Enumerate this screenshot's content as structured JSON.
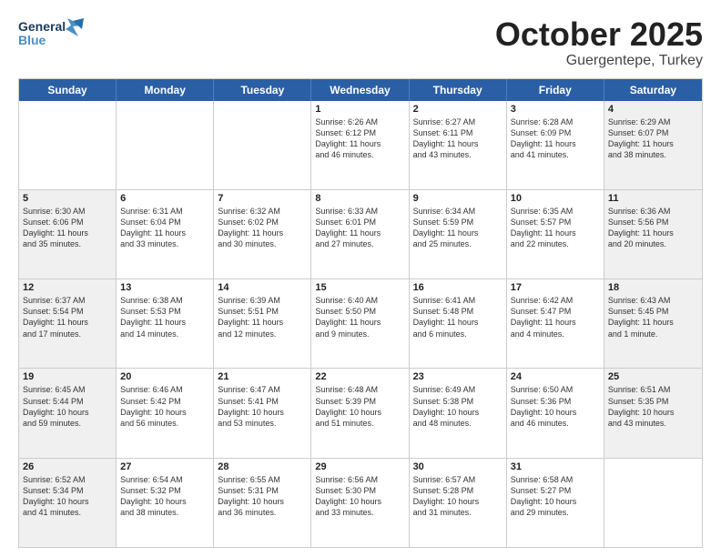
{
  "header": {
    "logo_line1": "General",
    "logo_line2": "Blue",
    "title": "October 2025",
    "subtitle": "Guergentepe, Turkey"
  },
  "calendar": {
    "weekdays": [
      "Sunday",
      "Monday",
      "Tuesday",
      "Wednesday",
      "Thursday",
      "Friday",
      "Saturday"
    ],
    "rows": [
      [
        {
          "day": "",
          "text": "",
          "empty": true
        },
        {
          "day": "",
          "text": "",
          "empty": true
        },
        {
          "day": "",
          "text": "",
          "empty": true
        },
        {
          "day": "1",
          "text": "Sunrise: 6:26 AM\nSunset: 6:12 PM\nDaylight: 11 hours\nand 46 minutes.",
          "shaded": false
        },
        {
          "day": "2",
          "text": "Sunrise: 6:27 AM\nSunset: 6:11 PM\nDaylight: 11 hours\nand 43 minutes.",
          "shaded": false
        },
        {
          "day": "3",
          "text": "Sunrise: 6:28 AM\nSunset: 6:09 PM\nDaylight: 11 hours\nand 41 minutes.",
          "shaded": false
        },
        {
          "day": "4",
          "text": "Sunrise: 6:29 AM\nSunset: 6:07 PM\nDaylight: 11 hours\nand 38 minutes.",
          "shaded": true
        }
      ],
      [
        {
          "day": "5",
          "text": "Sunrise: 6:30 AM\nSunset: 6:06 PM\nDaylight: 11 hours\nand 35 minutes.",
          "shaded": true
        },
        {
          "day": "6",
          "text": "Sunrise: 6:31 AM\nSunset: 6:04 PM\nDaylight: 11 hours\nand 33 minutes.",
          "shaded": false
        },
        {
          "day": "7",
          "text": "Sunrise: 6:32 AM\nSunset: 6:02 PM\nDaylight: 11 hours\nand 30 minutes.",
          "shaded": false
        },
        {
          "day": "8",
          "text": "Sunrise: 6:33 AM\nSunset: 6:01 PM\nDaylight: 11 hours\nand 27 minutes.",
          "shaded": false
        },
        {
          "day": "9",
          "text": "Sunrise: 6:34 AM\nSunset: 5:59 PM\nDaylight: 11 hours\nand 25 minutes.",
          "shaded": false
        },
        {
          "day": "10",
          "text": "Sunrise: 6:35 AM\nSunset: 5:57 PM\nDaylight: 11 hours\nand 22 minutes.",
          "shaded": false
        },
        {
          "day": "11",
          "text": "Sunrise: 6:36 AM\nSunset: 5:56 PM\nDaylight: 11 hours\nand 20 minutes.",
          "shaded": true
        }
      ],
      [
        {
          "day": "12",
          "text": "Sunrise: 6:37 AM\nSunset: 5:54 PM\nDaylight: 11 hours\nand 17 minutes.",
          "shaded": true
        },
        {
          "day": "13",
          "text": "Sunrise: 6:38 AM\nSunset: 5:53 PM\nDaylight: 11 hours\nand 14 minutes.",
          "shaded": false
        },
        {
          "day": "14",
          "text": "Sunrise: 6:39 AM\nSunset: 5:51 PM\nDaylight: 11 hours\nand 12 minutes.",
          "shaded": false
        },
        {
          "day": "15",
          "text": "Sunrise: 6:40 AM\nSunset: 5:50 PM\nDaylight: 11 hours\nand 9 minutes.",
          "shaded": false
        },
        {
          "day": "16",
          "text": "Sunrise: 6:41 AM\nSunset: 5:48 PM\nDaylight: 11 hours\nand 6 minutes.",
          "shaded": false
        },
        {
          "day": "17",
          "text": "Sunrise: 6:42 AM\nSunset: 5:47 PM\nDaylight: 11 hours\nand 4 minutes.",
          "shaded": false
        },
        {
          "day": "18",
          "text": "Sunrise: 6:43 AM\nSunset: 5:45 PM\nDaylight: 11 hours\nand 1 minute.",
          "shaded": true
        }
      ],
      [
        {
          "day": "19",
          "text": "Sunrise: 6:45 AM\nSunset: 5:44 PM\nDaylight: 10 hours\nand 59 minutes.",
          "shaded": true
        },
        {
          "day": "20",
          "text": "Sunrise: 6:46 AM\nSunset: 5:42 PM\nDaylight: 10 hours\nand 56 minutes.",
          "shaded": false
        },
        {
          "day": "21",
          "text": "Sunrise: 6:47 AM\nSunset: 5:41 PM\nDaylight: 10 hours\nand 53 minutes.",
          "shaded": false
        },
        {
          "day": "22",
          "text": "Sunrise: 6:48 AM\nSunset: 5:39 PM\nDaylight: 10 hours\nand 51 minutes.",
          "shaded": false
        },
        {
          "day": "23",
          "text": "Sunrise: 6:49 AM\nSunset: 5:38 PM\nDaylight: 10 hours\nand 48 minutes.",
          "shaded": false
        },
        {
          "day": "24",
          "text": "Sunrise: 6:50 AM\nSunset: 5:36 PM\nDaylight: 10 hours\nand 46 minutes.",
          "shaded": false
        },
        {
          "day": "25",
          "text": "Sunrise: 6:51 AM\nSunset: 5:35 PM\nDaylight: 10 hours\nand 43 minutes.",
          "shaded": true
        }
      ],
      [
        {
          "day": "26",
          "text": "Sunrise: 6:52 AM\nSunset: 5:34 PM\nDaylight: 10 hours\nand 41 minutes.",
          "shaded": true
        },
        {
          "day": "27",
          "text": "Sunrise: 6:54 AM\nSunset: 5:32 PM\nDaylight: 10 hours\nand 38 minutes.",
          "shaded": false
        },
        {
          "day": "28",
          "text": "Sunrise: 6:55 AM\nSunset: 5:31 PM\nDaylight: 10 hours\nand 36 minutes.",
          "shaded": false
        },
        {
          "day": "29",
          "text": "Sunrise: 6:56 AM\nSunset: 5:30 PM\nDaylight: 10 hours\nand 33 minutes.",
          "shaded": false
        },
        {
          "day": "30",
          "text": "Sunrise: 6:57 AM\nSunset: 5:28 PM\nDaylight: 10 hours\nand 31 minutes.",
          "shaded": false
        },
        {
          "day": "31",
          "text": "Sunrise: 6:58 AM\nSunset: 5:27 PM\nDaylight: 10 hours\nand 29 minutes.",
          "shaded": false
        },
        {
          "day": "",
          "text": "",
          "empty": true
        }
      ]
    ]
  }
}
